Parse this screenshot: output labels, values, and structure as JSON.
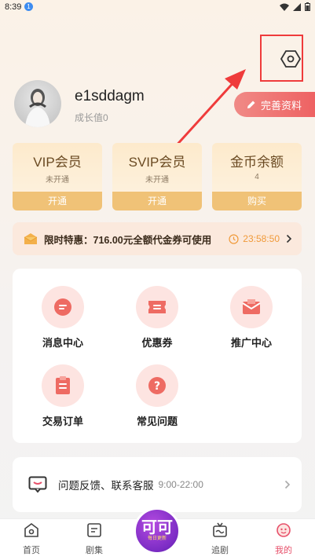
{
  "status": {
    "time": "8:39",
    "badge": "1"
  },
  "profile": {
    "username": "e1sddagm",
    "growth": "成长值0",
    "edit_label": "完善资料"
  },
  "cards": [
    {
      "title": "VIP会员",
      "sub": "未开通",
      "action": "开通"
    },
    {
      "title": "SVIP会员",
      "sub": "未开通",
      "action": "开通"
    },
    {
      "title": "金币余额",
      "sub": "4",
      "action": "购买"
    }
  ],
  "promo": {
    "text": "限时特惠：716.00元全额代金券可使用",
    "countdown": "23:58:50"
  },
  "grid": [
    {
      "label": "消息中心",
      "icon": "message-icon"
    },
    {
      "label": "优惠券",
      "icon": "coupon-icon"
    },
    {
      "label": "推广中心",
      "icon": "mail-icon"
    },
    {
      "label": "交易订单",
      "icon": "order-icon"
    },
    {
      "label": "常见问题",
      "icon": "question-icon"
    }
  ],
  "feedback": {
    "text": "问题反馈、联系客服",
    "hours": "9:00-22:00"
  },
  "tabs": [
    {
      "label": "首页",
      "icon": "home-icon"
    },
    {
      "label": "剧集",
      "icon": "list-icon"
    },
    {
      "label": "追剧",
      "icon": "tv-icon"
    },
    {
      "label": "我的",
      "icon": "profile-icon"
    }
  ],
  "center_logo": {
    "title": "可可",
    "sub": "每日更新"
  },
  "colors": {
    "accent": "#ee5f60",
    "card_button": "#f0c277",
    "annotation": "#ef3b3b",
    "tab_active": "#e7506a"
  }
}
